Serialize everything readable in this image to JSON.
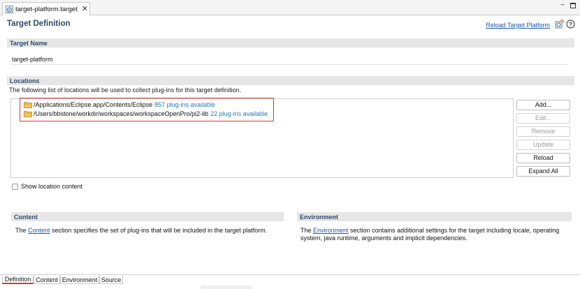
{
  "editor_tab": {
    "label": "target-platform.target",
    "close": "✕"
  },
  "window": {
    "minimize": "−"
  },
  "header": {
    "title": "Target Definition",
    "reload_label": "Reload Target Platform",
    "help": "?"
  },
  "target_name": {
    "heading": "Target Name",
    "value": "target-platform"
  },
  "locations": {
    "heading": "Locations",
    "description": "The following list of locations will be used to collect plug-ins for this target definition.",
    "items": [
      {
        "path": "/Applications/Eclipse.app/Contents/Eclipse",
        "count": "857 plug-ins available"
      },
      {
        "path": "/Users/bbstone/workdir/workspaces/workspaceOpenPro/pi2-lib",
        "count": "22 plug-ins available"
      }
    ],
    "buttons": {
      "add": "Add...",
      "edit": "Edit...",
      "remove": "Remove",
      "update": "Update",
      "reload": "Reload",
      "expand_all": "Expand All"
    },
    "show_content_label": "Show location content"
  },
  "content_section": {
    "heading": "Content",
    "pre": "The ",
    "link": "Content",
    "post": " section specifies the set of plug-ins that will be included in the target platform."
  },
  "environment_section": {
    "heading": "Environment",
    "pre": "The ",
    "link": "Environment",
    "post": " section contains additional settings for the target including locale, operating system, java runtime, arguments and implicit dependencies."
  },
  "page_tabs": [
    "Definition",
    "Content",
    "Environment",
    "Source"
  ],
  "colors": {
    "accent_red": "#d93a2a",
    "link_blue": "#1a5aa6",
    "title_blue": "#2e4a6b",
    "count_blue": "#1e7bb3"
  }
}
